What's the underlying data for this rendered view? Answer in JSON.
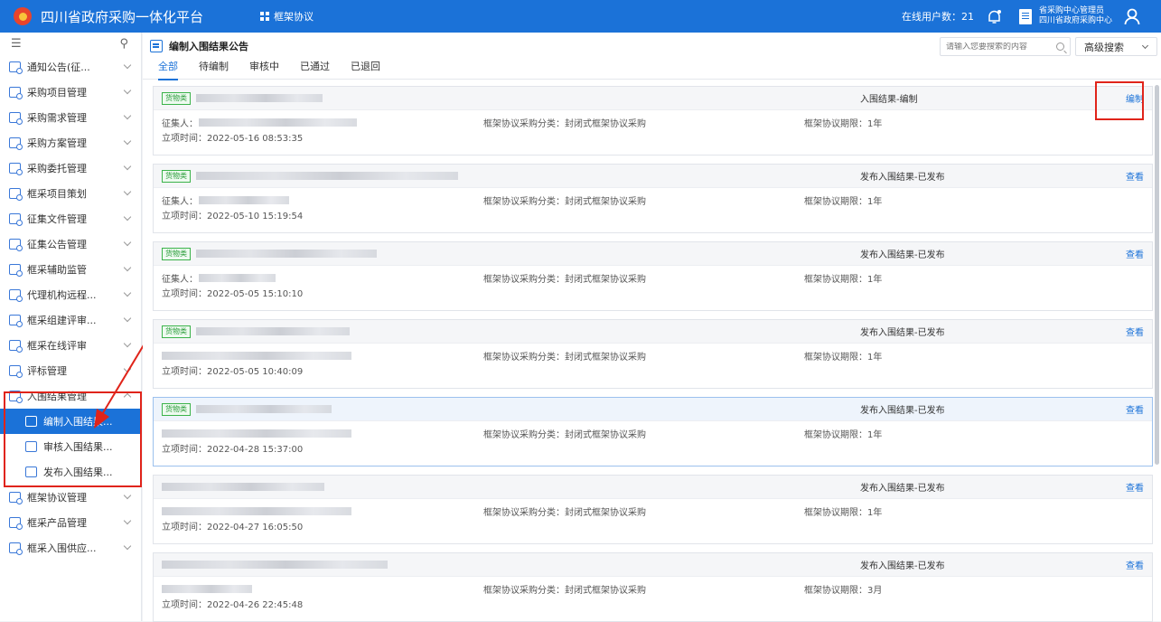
{
  "app": {
    "title": "四川省政府采购一体化平台",
    "top_menu": "框架协议",
    "online_users": "在线用户数：21",
    "user_role": "省采购中心管理员",
    "user_org": "四川省政府采购中心"
  },
  "sidebar": {
    "items": [
      {
        "label": "通知公告(征..."
      },
      {
        "label": "采购项目管理"
      },
      {
        "label": "采购需求管理"
      },
      {
        "label": "采购方案管理"
      },
      {
        "label": "采购委托管理"
      },
      {
        "label": "框采项目策划"
      },
      {
        "label": "征集文件管理"
      },
      {
        "label": "征集公告管理"
      },
      {
        "label": "框采辅助监管"
      },
      {
        "label": "代理机构远程..."
      },
      {
        "label": "框采组建评审..."
      },
      {
        "label": "框采在线评审"
      },
      {
        "label": "评标管理"
      },
      {
        "label": "入围结果管理"
      },
      {
        "label": "框架协议管理"
      },
      {
        "label": "框采产品管理"
      },
      {
        "label": "框采入围供应..."
      }
    ],
    "sub_items": [
      {
        "label": "编制入围结果..."
      },
      {
        "label": "审核入围结果..."
      },
      {
        "label": "发布入围结果..."
      }
    ]
  },
  "main": {
    "page_title": "编制入围结果公告",
    "search_placeholder": "请输入您要搜索的内容",
    "advanced_search": "高级搜索",
    "tabs": [
      "全部",
      "待编制",
      "审核中",
      "已通过",
      "已退回"
    ]
  },
  "cards": [
    {
      "tag": "货物类",
      "status": "入围结果-编制",
      "action": "编制",
      "collector": "征集人：",
      "category": "框架协议采购分类：封闭式框架协议采购",
      "period": "框架协议期限：1年",
      "created": "立项时间：2022-05-16 08:53:35"
    },
    {
      "tag": "货物类",
      "status": "发布入围结果-已发布",
      "action": "查看",
      "collector": "征集人：",
      "category": "框架协议采购分类：封闭式框架协议采购",
      "period": "框架协议期限：1年",
      "created": "立项时间：2022-05-10 15:19:54"
    },
    {
      "tag": "货物类",
      "status": "发布入围结果-已发布",
      "action": "查看",
      "collector": "征集人：",
      "category": "框架协议采购分类：封闭式框架协议采购",
      "period": "框架协议期限：1年",
      "created": "立项时间：2022-05-05 15:10:10"
    },
    {
      "tag": "货物类",
      "status": "发布入围结果-已发布",
      "action": "查看",
      "collector": "",
      "category": "框架协议采购分类：封闭式框架协议采购",
      "period": "框架协议期限：1年",
      "created": "立项时间：2022-05-05 10:40:09"
    },
    {
      "tag": "货物类",
      "status": "发布入围结果-已发布",
      "action": "查看",
      "collector": "",
      "category": "框架协议采购分类：封闭式框架协议采购",
      "period": "框架协议期限：1年",
      "created": "立项时间：2022-04-28 15:37:00"
    },
    {
      "tag": "",
      "status": "发布入围结果-已发布",
      "action": "查看",
      "collector": "",
      "category": "框架协议采购分类：封闭式框架协议采购",
      "period": "框架协议期限：1年",
      "created": "立项时间：2022-04-27 16:05:50"
    },
    {
      "tag": "",
      "status": "发布入围结果-已发布",
      "action": "查看",
      "collector": "",
      "category": "框架协议采购分类：封闭式框架协议采购",
      "period": "框架协议期限：3月",
      "created": "立项时间：2022-04-26 22:45:48"
    }
  ],
  "colors": {
    "brand": "#1b72d8",
    "highlight_red": "#e0241a",
    "tag_green": "#2a9d3a"
  }
}
